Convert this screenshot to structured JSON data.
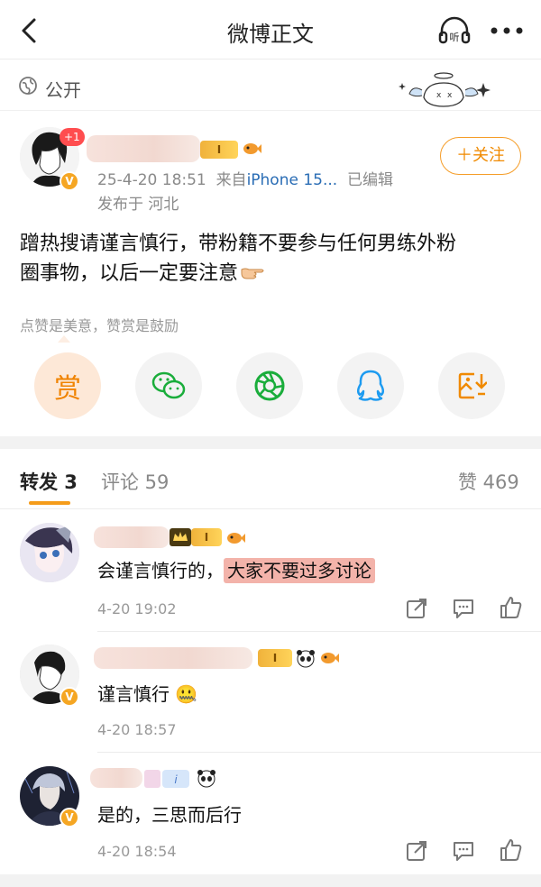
{
  "header": {
    "title": "微博正文"
  },
  "visibility": {
    "label": "公开"
  },
  "post": {
    "plus_badge": "+1",
    "level": "I",
    "verified": "V",
    "meta_date": "25-4-20 18:51",
    "meta_from": "来自",
    "meta_device": "iPhone 15...",
    "meta_edited": "已编辑",
    "location": "发布于 河北",
    "follow_label": "＋关注",
    "text_line1": "蹭热搜请谨言慎行，带粉籍不要参与任何男练外粉",
    "text_line2": "圈事物，以后一定要注意",
    "hint": "点赞是美意，赞赏是鼓励"
  },
  "share": {
    "reward_label": "赏",
    "icons": [
      "wechat-icon",
      "moments-icon",
      "qq-icon",
      "save-image-icon"
    ]
  },
  "tabs": {
    "repost": "转发 3",
    "comment": "评论 59",
    "like": "赞 469"
  },
  "comments": [
    {
      "text_plain": "会谨言慎行的，",
      "text_highlight": "大家不要过多讨论",
      "time": "4-20 19:02"
    },
    {
      "text_plain": "谨言慎行",
      "emoji": "🤐",
      "time": "4-20 18:57"
    },
    {
      "text_plain": "是的，三思而后行",
      "time": "4-20 18:54"
    }
  ],
  "colors": {
    "accent": "#f59c1a",
    "link": "#2a6db5",
    "highlight": "#f3b3aa"
  }
}
